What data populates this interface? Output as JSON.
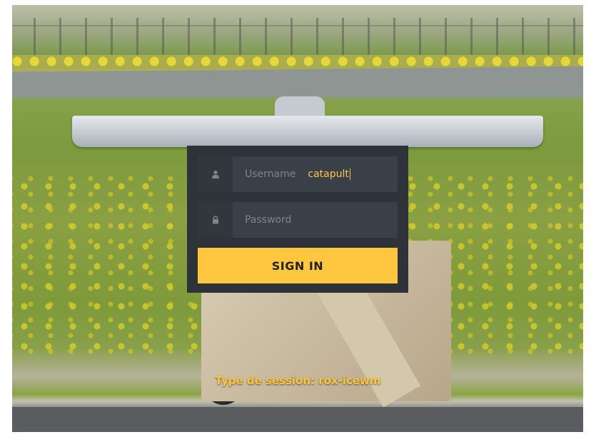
{
  "login": {
    "username_placeholder": "Username",
    "username_value": "catapult",
    "password_placeholder": "Password",
    "signin_label": "SIGN IN"
  },
  "session": {
    "label": "Type de session: rox-icewm"
  },
  "icons": {
    "user": "user-icon",
    "lock": "lock-icon"
  },
  "colors": {
    "accent": "#ffc640",
    "panel": "#2d3338",
    "field": "#3a4047",
    "text_accent": "#ffc44d"
  }
}
